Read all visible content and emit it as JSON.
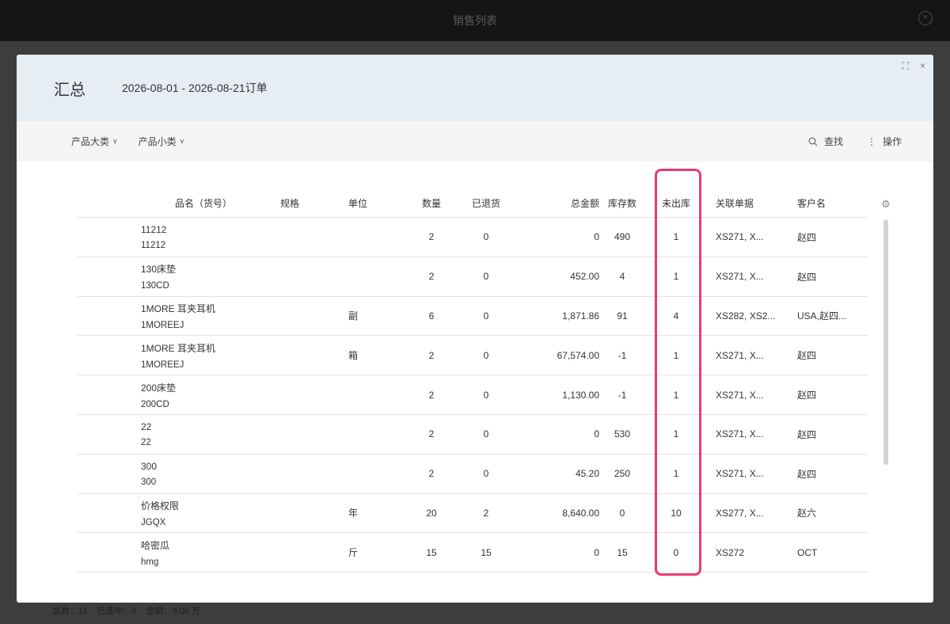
{
  "app": {
    "window_title": "销售列表",
    "close_glyph": "×"
  },
  "footer": {
    "total": "总数：11",
    "selected": "已选中：0",
    "amount": "金额：9.06 万"
  },
  "modal": {
    "title": "汇总",
    "subtitle": "2026-08-01 - 2026-08-21订单",
    "expand_glyph": "⛶",
    "close_glyph": "×"
  },
  "filters": {
    "category": "产品大类",
    "subcategory": "产品小类",
    "chevron": "∨",
    "search": "查找",
    "actions": "操作",
    "actions_glyph": "⋮"
  },
  "table": {
    "columns": {
      "name": "品名（货号）",
      "spec": "规格",
      "unit": "单位",
      "qty": "数量",
      "returned": "已退货",
      "amount": "总金额",
      "stock": "库存数",
      "unshipped": "未出库",
      "ref": "关联单据",
      "customer": "客户名"
    },
    "settings_glyph": "⚙",
    "rows": [
      {
        "name": "11212",
        "code": "11212",
        "spec": "",
        "unit": "",
        "qty": "2",
        "returned": "0",
        "amount": "0",
        "stock": "490",
        "unshipped": "1",
        "ref": "XS271, X...",
        "customer": "赵四"
      },
      {
        "name": "130床垫",
        "code": "130CD",
        "spec": "",
        "unit": "",
        "qty": "2",
        "returned": "0",
        "amount": "452.00",
        "stock": "4",
        "unshipped": "1",
        "ref": "XS271, X...",
        "customer": "赵四"
      },
      {
        "name": "1MORE 耳夹耳机",
        "code": "1MOREEJ",
        "spec": "",
        "unit": "副",
        "qty": "6",
        "returned": "0",
        "amount": "1,871.86",
        "stock": "91",
        "unshipped": "4",
        "ref": "XS282, XS2...",
        "customer": "USA,赵四..."
      },
      {
        "name": "1MORE 耳夹耳机",
        "code": "1MOREEJ",
        "spec": "",
        "unit": "箱",
        "qty": "2",
        "returned": "0",
        "amount": "67,574.00",
        "stock": "-1",
        "unshipped": "1",
        "ref": "XS271, X...",
        "customer": "赵四"
      },
      {
        "name": "200床垫",
        "code": "200CD",
        "spec": "",
        "unit": "",
        "qty": "2",
        "returned": "0",
        "amount": "1,130.00",
        "stock": "-1",
        "unshipped": "1",
        "ref": "XS271, X...",
        "customer": "赵四"
      },
      {
        "name": "22",
        "code": "22",
        "spec": "",
        "unit": "",
        "qty": "2",
        "returned": "0",
        "amount": "0",
        "stock": "530",
        "unshipped": "1",
        "ref": "XS271, X...",
        "customer": "赵四"
      },
      {
        "name": "300",
        "code": "300",
        "spec": "",
        "unit": "",
        "qty": "2",
        "returned": "0",
        "amount": "45.20",
        "stock": "250",
        "unshipped": "1",
        "ref": "XS271, X...",
        "customer": "赵四"
      },
      {
        "name": "价格权限",
        "code": "JGQX",
        "spec": "",
        "unit": "年",
        "qty": "20",
        "returned": "2",
        "amount": "8,640.00",
        "stock": "0",
        "unshipped": "10",
        "ref": "XS277, X...",
        "customer": "赵六"
      },
      {
        "name": "哈密瓜",
        "code": "hmg",
        "spec": "",
        "unit": "斤",
        "qty": "15",
        "returned": "15",
        "amount": "0",
        "stock": "15",
        "unshipped": "0",
        "ref": "XS272",
        "customer": "OCT"
      }
    ]
  },
  "colors": {
    "highlight": "#ec3a72",
    "header_bg": "#e6edf4",
    "overlay": "#3d3d3d"
  }
}
